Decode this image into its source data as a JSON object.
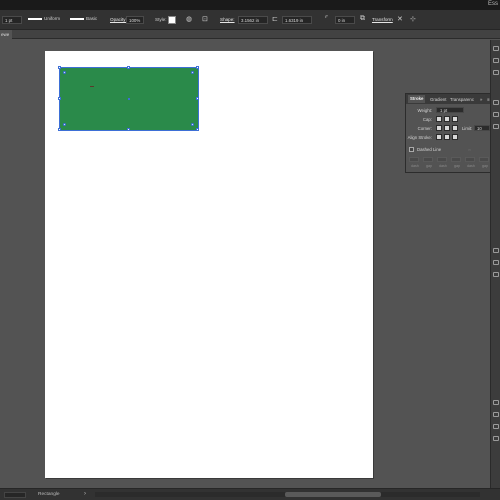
{
  "window": {
    "brand_text": "Ess"
  },
  "control_bar": {
    "stroke_weight": "1 pt",
    "stroke_profile": "Uniform",
    "brush": "Basic",
    "opacity_label": "Opacity:",
    "opacity_value": "100%",
    "style_label": "Style:",
    "shape_label": "Shape:",
    "width_value": "3.1562 in",
    "height_value": "1.6319 in",
    "corner_value": "0 in",
    "transform_label": "Transform",
    "icons": [
      "globe-icon",
      "align-icon",
      "link-icon",
      "transform-icon",
      "isolate-icon"
    ]
  },
  "tabs": [
    {
      "label": "ewe"
    }
  ],
  "canvas": {
    "artboard_color": "#ffffff",
    "shape": {
      "type": "Rectangle",
      "fill_color": "#2a8a4a",
      "selection_color": "#3d6fd6"
    }
  },
  "stroke_panel": {
    "tabs": [
      "Stroke",
      "Gradient",
      "Transparenc"
    ],
    "menu_icon": "panel-menu-icon",
    "weight_label": "Weight:",
    "weight_value": "1 pt",
    "cap_label": "Cap:",
    "corner_label": "Corner:",
    "limit_label": "Limit:",
    "limit_value": "10",
    "align_label": "Align Stroke:",
    "dashed_label": "Dashed Line",
    "dash_labels": [
      "dash",
      "gap",
      "dash",
      "gap",
      "dash",
      "gap"
    ]
  },
  "status_bar": {
    "zoom": "",
    "tool_name": "Rectangle"
  }
}
